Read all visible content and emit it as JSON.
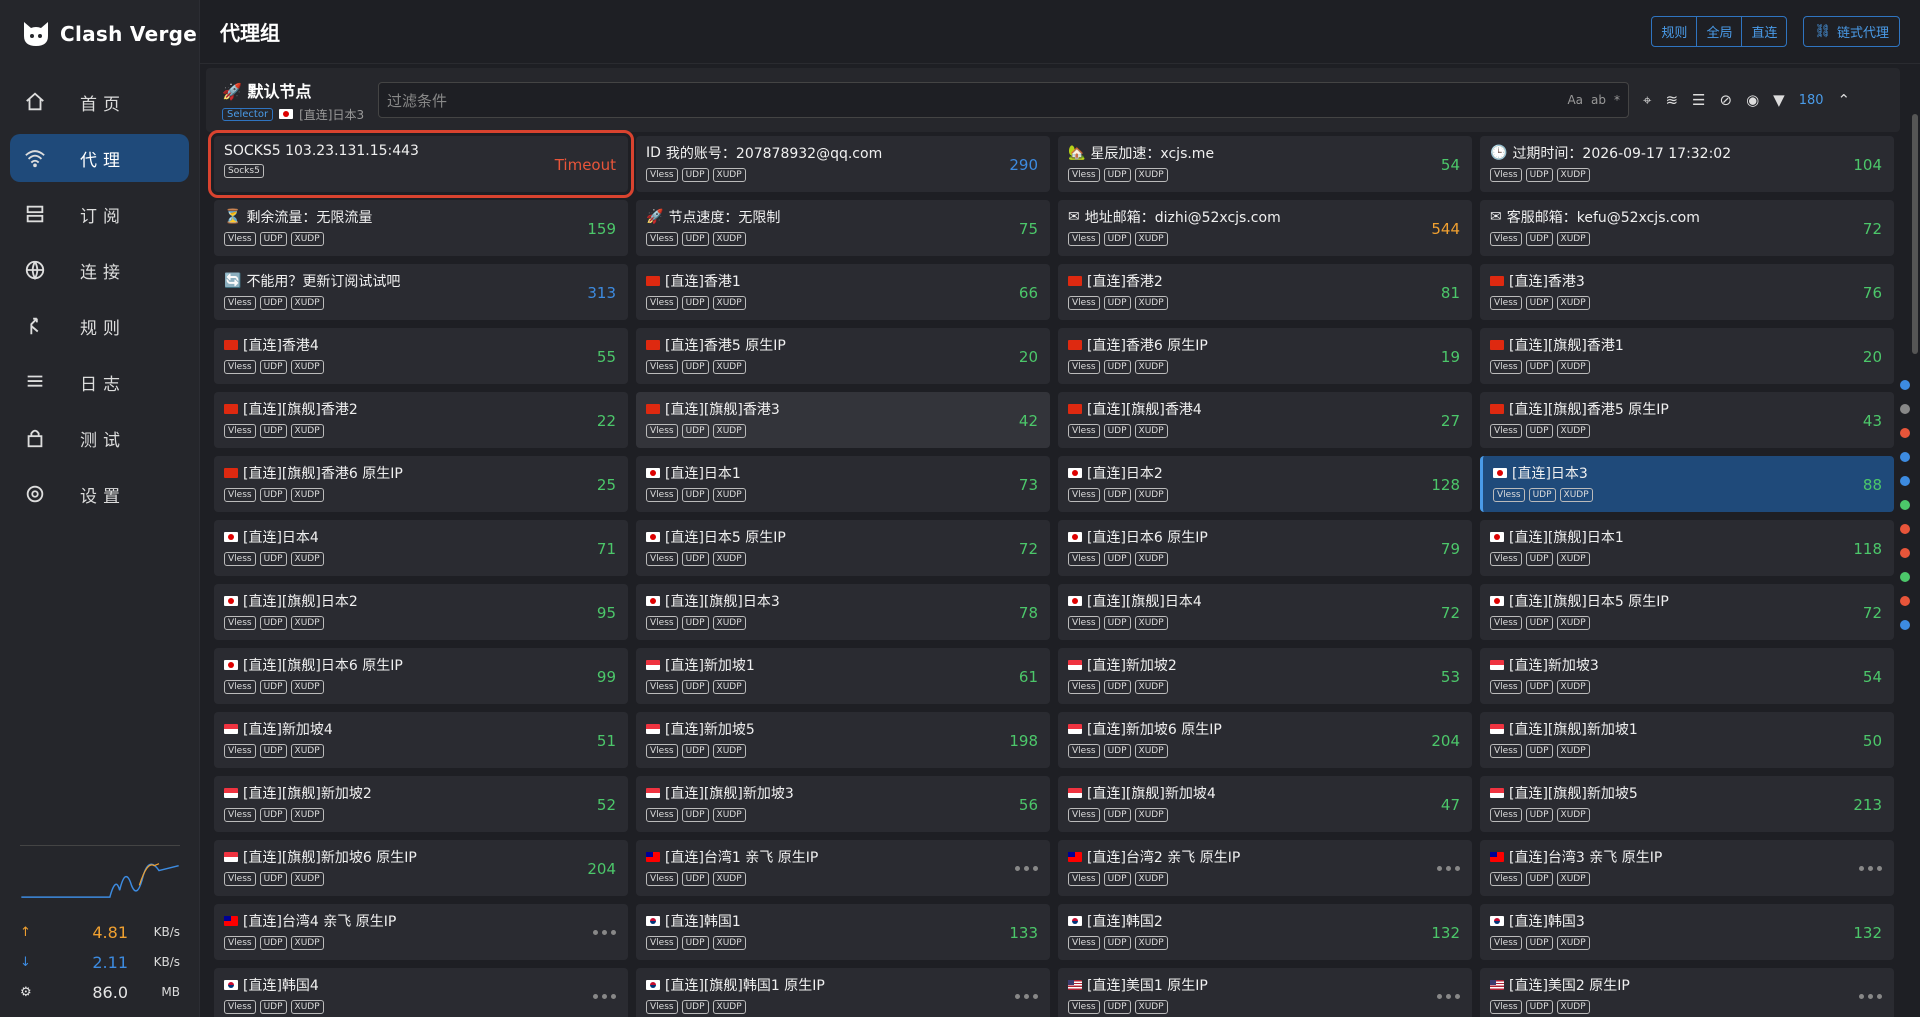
{
  "app": {
    "name": "Clash Verge"
  },
  "nav": [
    {
      "label": "首页",
      "icon": "home-icon"
    },
    {
      "label": "代理",
      "icon": "wifi-icon",
      "active": true
    },
    {
      "label": "订阅",
      "icon": "server-icon"
    },
    {
      "label": "连接",
      "icon": "globe-icon"
    },
    {
      "label": "规则",
      "icon": "split-icon"
    },
    {
      "label": "日志",
      "icon": "list-icon"
    },
    {
      "label": "测试",
      "icon": "lock-icon"
    },
    {
      "label": "设置",
      "icon": "gear-icon"
    }
  ],
  "traffic": {
    "up": "4.81",
    "up_unit": "KB/s",
    "down": "2.11",
    "down_unit": "KB/s",
    "mem": "86.0",
    "mem_unit": "MB"
  },
  "header": {
    "title": "代理组",
    "modes": [
      "规则",
      "全局",
      "直连"
    ],
    "chain_label": "链式代理"
  },
  "group": {
    "name": "默认节点",
    "type": "Selector",
    "current": "[直连]日本3",
    "filter_placeholder": "过滤条件",
    "filter_opts": [
      "Aa",
      "ab",
      "*"
    ],
    "count": "180"
  },
  "colors": {
    "green": "#4cc76a",
    "blue": "#3d8be0",
    "orange": "#f0a030",
    "red": "#e8553a"
  },
  "nodes": [
    {
      "name": "SOCKS5 103.23.131.15:443",
      "tags": [
        "Socks5"
      ],
      "delay": "Timeout",
      "color": "red",
      "state": "timeout"
    },
    {
      "name": "我的账号：207878932@qq.com",
      "tags": [
        "Vless",
        "UDP",
        "XUDP"
      ],
      "delay": "290",
      "color": "blue",
      "icon": "ID"
    },
    {
      "name": "星辰加速：xcjs.me",
      "tags": [
        "Vless",
        "UDP",
        "XUDP"
      ],
      "delay": "54",
      "color": "green",
      "icon": "🏡"
    },
    {
      "name": "过期时间：2026-09-17 17:32:02",
      "tags": [
        "Vless",
        "UDP",
        "XUDP"
      ],
      "delay": "104",
      "color": "green",
      "icon": "🕒"
    },
    {
      "name": "剩余流量：无限流量",
      "tags": [
        "Vless",
        "UDP",
        "XUDP"
      ],
      "delay": "159",
      "color": "green",
      "icon": "⏳"
    },
    {
      "name": "节点速度：无限制",
      "tags": [
        "Vless",
        "UDP",
        "XUDP"
      ],
      "delay": "75",
      "color": "green",
      "icon": "🚀"
    },
    {
      "name": "地址邮箱：dizhi@52xcjs.com",
      "tags": [
        "Vless",
        "UDP",
        "XUDP"
      ],
      "delay": "544",
      "color": "orange",
      "icon": "✉"
    },
    {
      "name": "客服邮箱：kefu@52xcjs.com",
      "tags": [
        "Vless",
        "UDP",
        "XUDP"
      ],
      "delay": "72",
      "color": "green",
      "icon": "✉"
    },
    {
      "name": "不能用？更新订阅试试吧",
      "tags": [
        "Vless",
        "UDP",
        "XUDP"
      ],
      "delay": "313",
      "color": "blue",
      "icon": "🔄"
    },
    {
      "name": "[直连]香港1",
      "tags": [
        "Vless",
        "UDP",
        "XUDP"
      ],
      "delay": "66",
      "color": "green",
      "flag": "hk"
    },
    {
      "name": "[直连]香港2",
      "tags": [
        "Vless",
        "UDP",
        "XUDP"
      ],
      "delay": "81",
      "color": "green",
      "flag": "hk"
    },
    {
      "name": "[直连]香港3",
      "tags": [
        "Vless",
        "UDP",
        "XUDP"
      ],
      "delay": "76",
      "color": "green",
      "flag": "hk"
    },
    {
      "name": "[直连]香港4",
      "tags": [
        "Vless",
        "UDP",
        "XUDP"
      ],
      "delay": "55",
      "color": "green",
      "flag": "hk"
    },
    {
      "name": "[直连]香港5 原生IP",
      "tags": [
        "Vless",
        "UDP",
        "XUDP"
      ],
      "delay": "20",
      "color": "green",
      "flag": "hk"
    },
    {
      "name": "[直连]香港6 原生IP",
      "tags": [
        "Vless",
        "UDP",
        "XUDP"
      ],
      "delay": "19",
      "color": "green",
      "flag": "hk"
    },
    {
      "name": "[直连][旗舰]香港1",
      "tags": [
        "Vless",
        "UDP",
        "XUDP"
      ],
      "delay": "20",
      "color": "green",
      "flag": "hk"
    },
    {
      "name": "[直连][旗舰]香港2",
      "tags": [
        "Vless",
        "UDP",
        "XUDP"
      ],
      "delay": "22",
      "color": "green",
      "flag": "hk"
    },
    {
      "name": "[直连][旗舰]香港3",
      "tags": [
        "Vless",
        "UDP",
        "XUDP"
      ],
      "delay": "42",
      "color": "green",
      "flag": "hk",
      "state": "hover"
    },
    {
      "name": "[直连][旗舰]香港4",
      "tags": [
        "Vless",
        "UDP",
        "XUDP"
      ],
      "delay": "27",
      "color": "green",
      "flag": "hk"
    },
    {
      "name": "[直连][旗舰]香港5 原生IP",
      "tags": [
        "Vless",
        "UDP",
        "XUDP"
      ],
      "delay": "43",
      "color": "green",
      "flag": "hk"
    },
    {
      "name": "[直连][旗舰]香港6 原生IP",
      "tags": [
        "Vless",
        "UDP",
        "XUDP"
      ],
      "delay": "25",
      "color": "green",
      "flag": "hk"
    },
    {
      "name": "[直连]日本1",
      "tags": [
        "Vless",
        "UDP",
        "XUDP"
      ],
      "delay": "73",
      "color": "green",
      "flag": "jp"
    },
    {
      "name": "[直连]日本2",
      "tags": [
        "Vless",
        "UDP",
        "XUDP"
      ],
      "delay": "128",
      "color": "green",
      "flag": "jp"
    },
    {
      "name": "[直连]日本3",
      "tags": [
        "Vless",
        "UDP",
        "XUDP"
      ],
      "delay": "88",
      "color": "green",
      "flag": "jp",
      "state": "selected"
    },
    {
      "name": "[直连]日本4",
      "tags": [
        "Vless",
        "UDP",
        "XUDP"
      ],
      "delay": "71",
      "color": "green",
      "flag": "jp"
    },
    {
      "name": "[直连]日本5 原生IP",
      "tags": [
        "Vless",
        "UDP",
        "XUDP"
      ],
      "delay": "72",
      "color": "green",
      "flag": "jp"
    },
    {
      "name": "[直连]日本6 原生IP",
      "tags": [
        "Vless",
        "UDP",
        "XUDP"
      ],
      "delay": "79",
      "color": "green",
      "flag": "jp"
    },
    {
      "name": "[直连][旗舰]日本1",
      "tags": [
        "Vless",
        "UDP",
        "XUDP"
      ],
      "delay": "118",
      "color": "green",
      "flag": "jp"
    },
    {
      "name": "[直连][旗舰]日本2",
      "tags": [
        "Vless",
        "UDP",
        "XUDP"
      ],
      "delay": "95",
      "color": "green",
      "flag": "jp"
    },
    {
      "name": "[直连][旗舰]日本3",
      "tags": [
        "Vless",
        "UDP",
        "XUDP"
      ],
      "delay": "78",
      "color": "green",
      "flag": "jp"
    },
    {
      "name": "[直连][旗舰]日本4",
      "tags": [
        "Vless",
        "UDP",
        "XUDP"
      ],
      "delay": "72",
      "color": "green",
      "flag": "jp"
    },
    {
      "name": "[直连][旗舰]日本5 原生IP",
      "tags": [
        "Vless",
        "UDP",
        "XUDP"
      ],
      "delay": "72",
      "color": "green",
      "flag": "jp"
    },
    {
      "name": "[直连][旗舰]日本6 原生IP",
      "tags": [
        "Vless",
        "UDP",
        "XUDP"
      ],
      "delay": "99",
      "color": "green",
      "flag": "jp"
    },
    {
      "name": "[直连]新加坡1",
      "tags": [
        "Vless",
        "UDP",
        "XUDP"
      ],
      "delay": "61",
      "color": "green",
      "flag": "sg"
    },
    {
      "name": "[直连]新加坡2",
      "tags": [
        "Vless",
        "UDP",
        "XUDP"
      ],
      "delay": "53",
      "color": "green",
      "flag": "sg"
    },
    {
      "name": "[直连]新加坡3",
      "tags": [
        "Vless",
        "UDP",
        "XUDP"
      ],
      "delay": "54",
      "color": "green",
      "flag": "sg"
    },
    {
      "name": "[直连]新加坡4",
      "tags": [
        "Vless",
        "UDP",
        "XUDP"
      ],
      "delay": "51",
      "color": "green",
      "flag": "sg"
    },
    {
      "name": "[直连]新加坡5",
      "tags": [
        "Vless",
        "UDP",
        "XUDP"
      ],
      "delay": "198",
      "color": "green",
      "flag": "sg"
    },
    {
      "name": "[直连]新加坡6 原生IP",
      "tags": [
        "Vless",
        "UDP",
        "XUDP"
      ],
      "delay": "204",
      "color": "green",
      "flag": "sg"
    },
    {
      "name": "[直连][旗舰]新加坡1",
      "tags": [
        "Vless",
        "UDP",
        "XUDP"
      ],
      "delay": "50",
      "color": "green",
      "flag": "sg"
    },
    {
      "name": "[直连][旗舰]新加坡2",
      "tags": [
        "Vless",
        "UDP",
        "XUDP"
      ],
      "delay": "52",
      "color": "green",
      "flag": "sg"
    },
    {
      "name": "[直连][旗舰]新加坡3",
      "tags": [
        "Vless",
        "UDP",
        "XUDP"
      ],
      "delay": "56",
      "color": "green",
      "flag": "sg"
    },
    {
      "name": "[直连][旗舰]新加坡4",
      "tags": [
        "Vless",
        "UDP",
        "XUDP"
      ],
      "delay": "47",
      "color": "green",
      "flag": "sg"
    },
    {
      "name": "[直连][旗舰]新加坡5",
      "tags": [
        "Vless",
        "UDP",
        "XUDP"
      ],
      "delay": "213",
      "color": "green",
      "flag": "sg"
    },
    {
      "name": "[直连][旗舰]新加坡6 原生IP",
      "tags": [
        "Vless",
        "UDP",
        "XUDP"
      ],
      "delay": "204",
      "color": "green",
      "flag": "sg"
    },
    {
      "name": "[直连]台湾1 亲飞 原生IP",
      "tags": [
        "Vless",
        "UDP",
        "XUDP"
      ],
      "delay": "",
      "flag": "tw"
    },
    {
      "name": "[直连]台湾2 亲飞 原生IP",
      "tags": [
        "Vless",
        "UDP",
        "XUDP"
      ],
      "delay": "",
      "flag": "tw"
    },
    {
      "name": "[直连]台湾3 亲飞 原生IP",
      "tags": [
        "Vless",
        "UDP",
        "XUDP"
      ],
      "delay": "",
      "flag": "tw"
    },
    {
      "name": "[直连]台湾4 亲飞 原生IP",
      "tags": [
        "Vless",
        "UDP",
        "XUDP"
      ],
      "delay": "",
      "flag": "tw"
    },
    {
      "name": "[直连]韩国1",
      "tags": [
        "Vless",
        "UDP",
        "XUDP"
      ],
      "delay": "133",
      "color": "green",
      "flag": "kr"
    },
    {
      "name": "[直连]韩国2",
      "tags": [
        "Vless",
        "UDP",
        "XUDP"
      ],
      "delay": "132",
      "color": "green",
      "flag": "kr"
    },
    {
      "name": "[直连]韩国3",
      "tags": [
        "Vless",
        "UDP",
        "XUDP"
      ],
      "delay": "132",
      "color": "green",
      "flag": "kr"
    },
    {
      "name": "[直连]韩国4",
      "tags": [
        "Vless",
        "UDP",
        "XUDP"
      ],
      "delay": "",
      "flag": "kr"
    },
    {
      "name": "[直连][旗舰]韩国1 原生IP",
      "tags": [
        "Vless",
        "UDP",
        "XUDP"
      ],
      "delay": "",
      "flag": "kr"
    },
    {
      "name": "[直连]美国1 原生IP",
      "tags": [
        "Vless",
        "UDP",
        "XUDP"
      ],
      "delay": "",
      "flag": "us"
    },
    {
      "name": "[直连]美国2 原生IP",
      "tags": [
        "Vless",
        "UDP",
        "XUDP"
      ],
      "delay": "",
      "flag": "us"
    }
  ]
}
